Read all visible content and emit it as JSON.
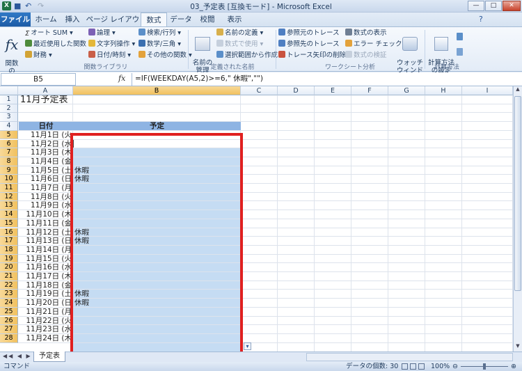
{
  "window": {
    "title": "03_予定表 [互換モード] - Microsoft Excel"
  },
  "tabs": [
    "ファイル",
    "ホーム",
    "挿入",
    "ページ レイアウト",
    "数式",
    "データ",
    "校閲",
    "表示"
  ],
  "ribbon": {
    "insert_function": "関数の\n挿入",
    "lib": {
      "autosum": "オート SUM",
      "recent": "最近使用した関数",
      "financial": "財務",
      "logical": "論理",
      "text": "文字列操作",
      "datetime": "日付/時刻",
      "lookup": "検索/行列",
      "math": "数学/三角",
      "more": "その他の関数",
      "label": "関数ライブラリ"
    },
    "names": {
      "manager": "名前の\n管理",
      "define": "名前の定義",
      "use": "数式で使用",
      "create": "選択範囲から作成",
      "label": "定義された名前"
    },
    "audit": {
      "precedents": "参照元のトレース",
      "dependents": "参照先のトレース",
      "remove": "トレース矢印の削除",
      "show": "数式の表示",
      "error": "エラー チェック",
      "evaluate": "数式の検証",
      "watch": "ウォッチ\nウィンドウ",
      "label": "ワークシート分析"
    },
    "calc": {
      "options": "計算方法\nの設定",
      "label": "計算方法"
    }
  },
  "formula_bar": {
    "name": "B5",
    "fx": "fx",
    "formula": "=IF(WEEKDAY(A5,2)>=6,\" 休暇\",\"\")"
  },
  "columns": [
    "A",
    "B",
    "C",
    "D",
    "E",
    "F",
    "G",
    "H",
    "I"
  ],
  "rows": [
    "1",
    "2",
    "3",
    "4",
    "5",
    "6",
    "7",
    "8",
    "9",
    "10",
    "11",
    "12",
    "13",
    "14",
    "15",
    "16",
    "17",
    "18",
    "19",
    "20",
    "21",
    "22",
    "23",
    "24",
    "25",
    "26",
    "27",
    "28"
  ],
  "sheet": {
    "title": "11月予定表",
    "header_date": "日付",
    "header_plan": "予定",
    "dates": [
      "11月1日 (火",
      "11月2日 (水",
      "11月3日 (木",
      "11月4日 (金",
      "11月5日 (土",
      "11月6日 (日",
      "11月7日 (月",
      "11月8日 (火",
      "11月9日 (水",
      "11月10日 (木",
      "11月11日 (金",
      "11月12日 (土",
      "11月13日 (日",
      "11月14日 (月",
      "11月15日 (火",
      "11月16日 (水",
      "11月17日 (木",
      "11月18日 (金",
      "11月19日 (土",
      "11月20日 (日",
      "11月21日 (月",
      "11月22日 (火",
      "11月23日 (水",
      "11月24日 (木"
    ],
    "plans": [
      "",
      "",
      "",
      "",
      "休暇",
      "休暇",
      "",
      "",
      "",
      "",
      "",
      "休暇",
      "休暇",
      "",
      "",
      "",
      "",
      "",
      "休暇",
      "休暇",
      "",
      "",
      "",
      ""
    ]
  },
  "sheet_tab": "予定表",
  "status": {
    "mode": "コマンド",
    "count": "データの個数: 30",
    "zoom": "100%"
  }
}
